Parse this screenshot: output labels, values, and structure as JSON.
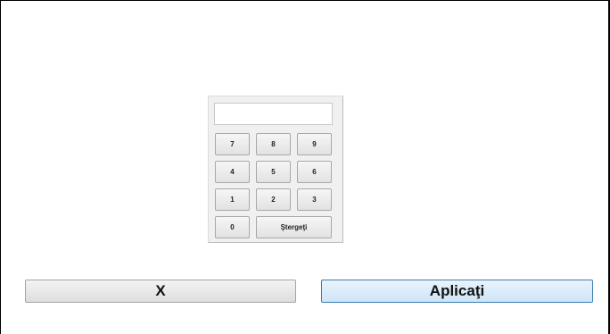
{
  "keypad": {
    "display_value": "",
    "keys": {
      "k7": "7",
      "k8": "8",
      "k9": "9",
      "k4": "4",
      "k5": "5",
      "k6": "6",
      "k1": "1",
      "k2": "2",
      "k3": "3",
      "k0": "0",
      "clear": "Ştergeţi"
    }
  },
  "actions": {
    "cancel_label": "X",
    "apply_label": "Aplicaţi"
  },
  "colors": {
    "apply_border": "#3c7fb1",
    "apply_fill": "#d9ebfa",
    "frame_border": "#000000"
  }
}
